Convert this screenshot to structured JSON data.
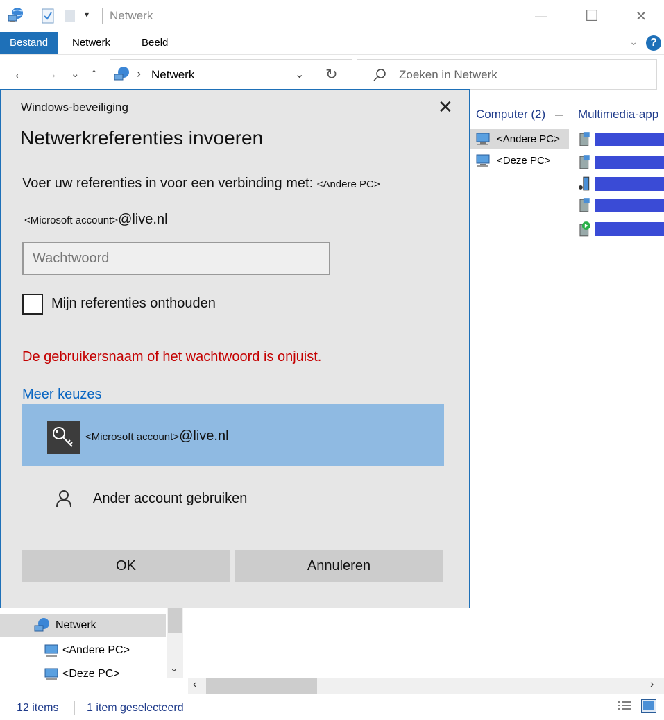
{
  "window": {
    "title": "Netwerk",
    "minimize_glyph": "—",
    "maximize_glyph": "☐",
    "close_glyph": "✕"
  },
  "ribbon": {
    "tabs": [
      {
        "label": "Bestand",
        "active": true
      },
      {
        "label": "Netwerk",
        "active": false
      },
      {
        "label": "Beeld",
        "active": false
      }
    ],
    "help": "?",
    "expand_glyph": "⌄"
  },
  "navigation": {
    "back": "←",
    "forward": "→",
    "recent": "⌄",
    "up": "↑",
    "separator": "›",
    "address": "Netwerk",
    "refresh": "↻",
    "search_placeholder": "Zoeken in Netwerk"
  },
  "content": {
    "groups": [
      {
        "label": "Computer (2)"
      },
      {
        "label": "Multimedia-app"
      }
    ],
    "computers": [
      {
        "label": "<Andere PC>",
        "selected": true
      },
      {
        "label": "<Deze PC>",
        "selected": false
      }
    ],
    "media_devices": [
      "media-device-icon",
      "media-device-icon",
      "media-phone-icon",
      "media-device-icon",
      "media-player-icon"
    ],
    "redaction_color": "#3a4bd6"
  },
  "nav_pane": {
    "items": [
      {
        "label": "Netwerk",
        "selected": true
      },
      {
        "label": "<Andere PC>",
        "selected": false
      },
      {
        "label": "<Deze PC>",
        "selected": false
      }
    ]
  },
  "status": {
    "items": "12 items",
    "selected": "1 item geselecteerd"
  },
  "dialog": {
    "caption": "Windows-beveiliging",
    "close_glyph": "✕",
    "heading": "Netwerkreferenties invoeren",
    "prompt": "Voer uw referenties in voor een verbinding met:",
    "target": "<Andere PC>",
    "account_prefix": "<Microsoft account>",
    "account_suffix": "@live.nl",
    "password_placeholder": "Wachtwoord",
    "remember_label": "Mijn referenties onthouden",
    "remember_checked": false,
    "error": "De gebruikersnaam of het wachtwoord is onjuist.",
    "more_choices": "Meer keuzes",
    "selected_account_prefix": "<Microsoft account>",
    "selected_account_suffix": "@live.nl",
    "other_account": "Ander account gebruiken",
    "ok": "OK",
    "cancel": "Annuleren",
    "accent": "#1e70b8",
    "error_color": "#c40000",
    "link_color": "#0a66c2",
    "selection_color": "#8fbae2"
  }
}
